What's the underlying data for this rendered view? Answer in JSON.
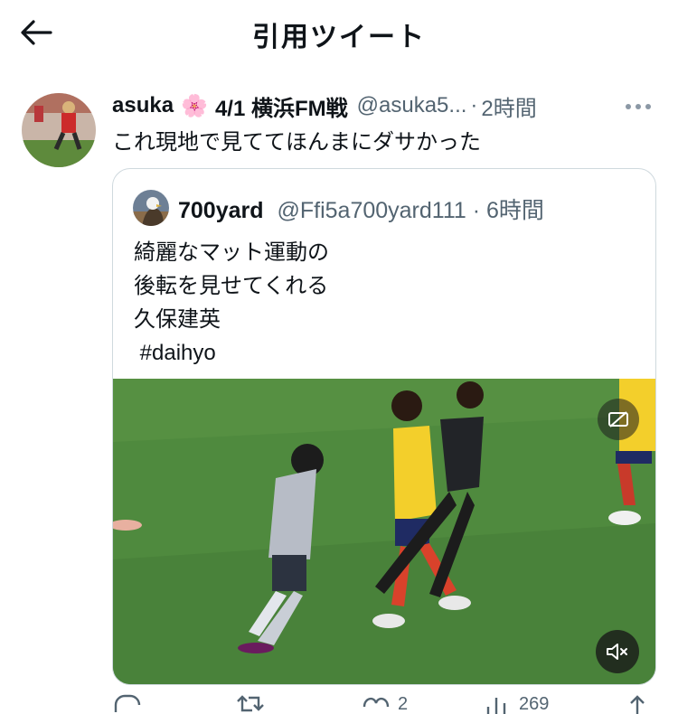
{
  "header": {
    "title": "引用ツイート"
  },
  "tweet": {
    "author_name": "asuka",
    "author_emoji": "🌸",
    "author_event": "4/1 横浜FM戦",
    "handle": "@asuka5...",
    "time_sep": "·",
    "time": "2時間",
    "text": "これ現地で見ててほんまにダサかった"
  },
  "quoted": {
    "author_name": "700yard",
    "handle": "@Ffi5a700yard111",
    "time_sep": "·",
    "time": "6時間",
    "lines": [
      "綺麗なマット運動の",
      "後転を見せてくれる",
      "久保建英",
      " #daihyo"
    ]
  },
  "actions": {
    "likes": "2",
    "views": "269"
  },
  "colors": {
    "text": "#0f1419",
    "muted": "#536471",
    "border": "#cfd9de",
    "pitch": "#4f8a3e"
  },
  "icons": [
    "back-arrow-icon",
    "more-icon",
    "cc-icon",
    "mute-icon",
    "reply-icon",
    "retweet-icon",
    "like-icon",
    "views-icon",
    "share-icon"
  ]
}
